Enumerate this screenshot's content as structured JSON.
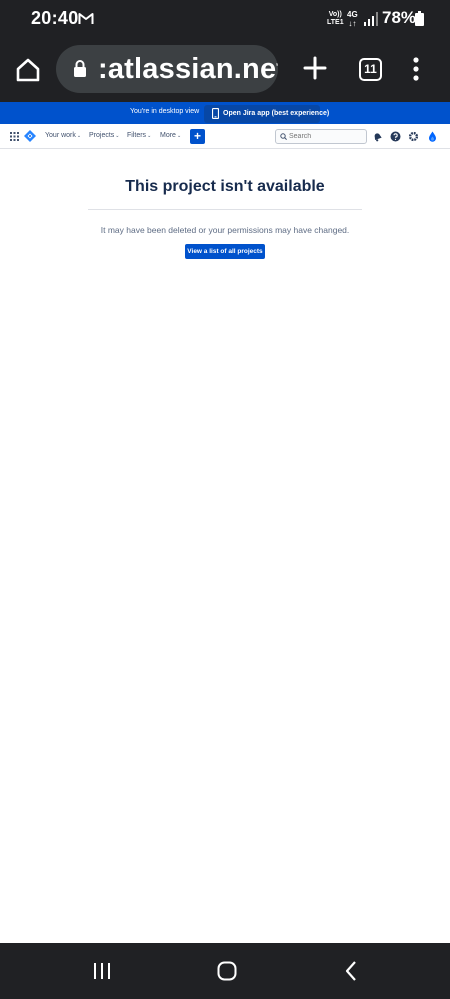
{
  "status_bar": {
    "time": "20:40",
    "volte_line1": "Vo))",
    "volte_line2": "LTE1",
    "network_type": "4G",
    "network_arrows": "↓↑",
    "battery": "78%"
  },
  "browser": {
    "url": ":atlassian.net",
    "tab_count": "11"
  },
  "banner": {
    "text": "You're in desktop view",
    "button_label": "Open Jira app (best experience)"
  },
  "nav": {
    "items": [
      {
        "label": "Your work"
      },
      {
        "label": "Projects"
      },
      {
        "label": "Filters"
      },
      {
        "label": "More"
      }
    ],
    "create_label": "+",
    "search_placeholder": "Search"
  },
  "content": {
    "title": "This project isn't available",
    "message": "It may have been deleted or your permissions may have changed.",
    "button_label": "View a list of all projects"
  },
  "colors": {
    "system_bar": "#202124",
    "jira_blue": "#0052cc",
    "text_dark": "#172b4d",
    "text_subtle": "#5e6c84"
  }
}
